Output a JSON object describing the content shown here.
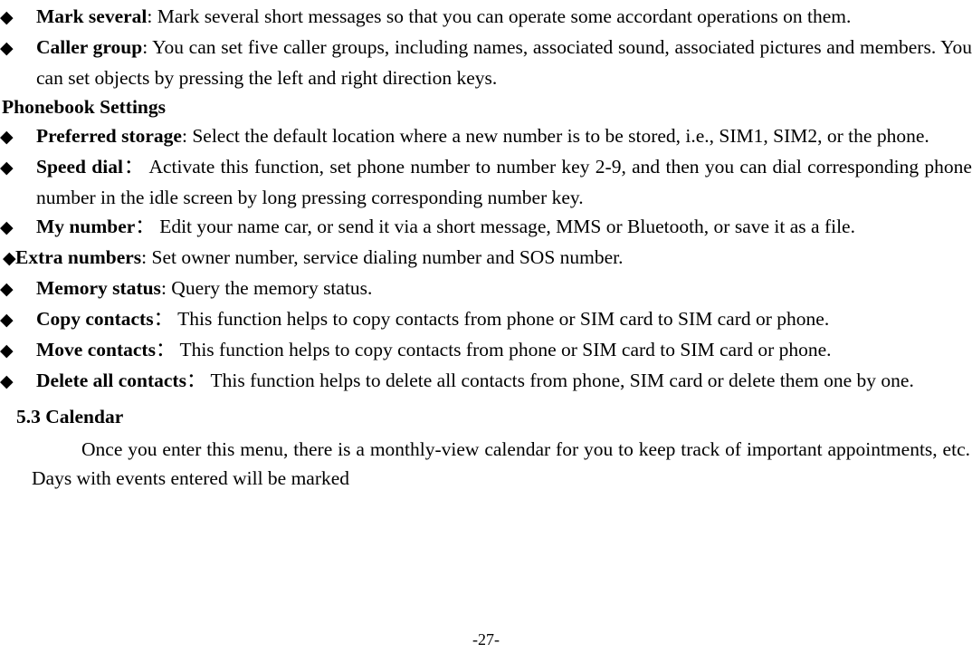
{
  "page": {
    "footer_page_number": "-27-",
    "bullet_glyph": "◆",
    "text_color": "#000000",
    "background_color": "#ffffff"
  },
  "content": {
    "continued_bullets": [
      {
        "bullet": "◆",
        "term": "Mark several",
        "separator": ":",
        "description": " Mark several short messages so that you can operate some accordant operations on them."
      },
      {
        "bullet": "◆",
        "term": "Caller group",
        "separator": ":",
        "description": " You can set five caller groups, including names, associated sound, associated pictures and members. You can set objects by pressing the left and right direction keys."
      }
    ],
    "phonebook_settings": {
      "heading": "Phonebook Settings",
      "items": [
        {
          "bullet": "◆",
          "term": "Preferred storage",
          "separator": ":",
          "description": " Select the default location where a new number is to be stored, i.e., SIM1, SIM2, or the phone."
        },
        {
          "bullet": "◆",
          "term": "Speed dial",
          "separator": "：",
          "description": " Activate this function, set phone number to number key 2-9, and then you can dial corresponding phone number in the idle screen by long pressing corresponding number key."
        },
        {
          "bullet": "◆",
          "term": "My number",
          "separator": "：",
          "description": " Edit your name car, or send it via a short message, MMS or Bluetooth, or save it as a file."
        },
        {
          "bullet": "◆",
          "term": "Extra numbers",
          "separator": ":",
          "description": " Set owner number, service dialing number and SOS number.",
          "tight": true
        },
        {
          "bullet": "◆",
          "term": "Memory status",
          "separator": ":",
          "description": " Query the memory status."
        },
        {
          "bullet": "◆",
          "term": "Copy contacts",
          "separator": "：",
          "description": " This function helps to copy contacts from phone or SIM card to SIM card or phone."
        },
        {
          "bullet": "◆",
          "term": "Move contacts",
          "separator": "：",
          "description": " This function helps to copy contacts from phone or SIM card to SIM card or phone."
        },
        {
          "bullet": "◆",
          "term": "Delete all contacts",
          "separator": "：",
          "description": " This function helps to delete all contacts from phone, SIM card or delete them one by one."
        }
      ]
    },
    "calendar_section": {
      "heading": "5.3 Calendar",
      "paragraph": "Once you enter this menu, there is a monthly-view calendar for you to keep track of important appointments, etc. Days with events entered will be marked"
    }
  }
}
